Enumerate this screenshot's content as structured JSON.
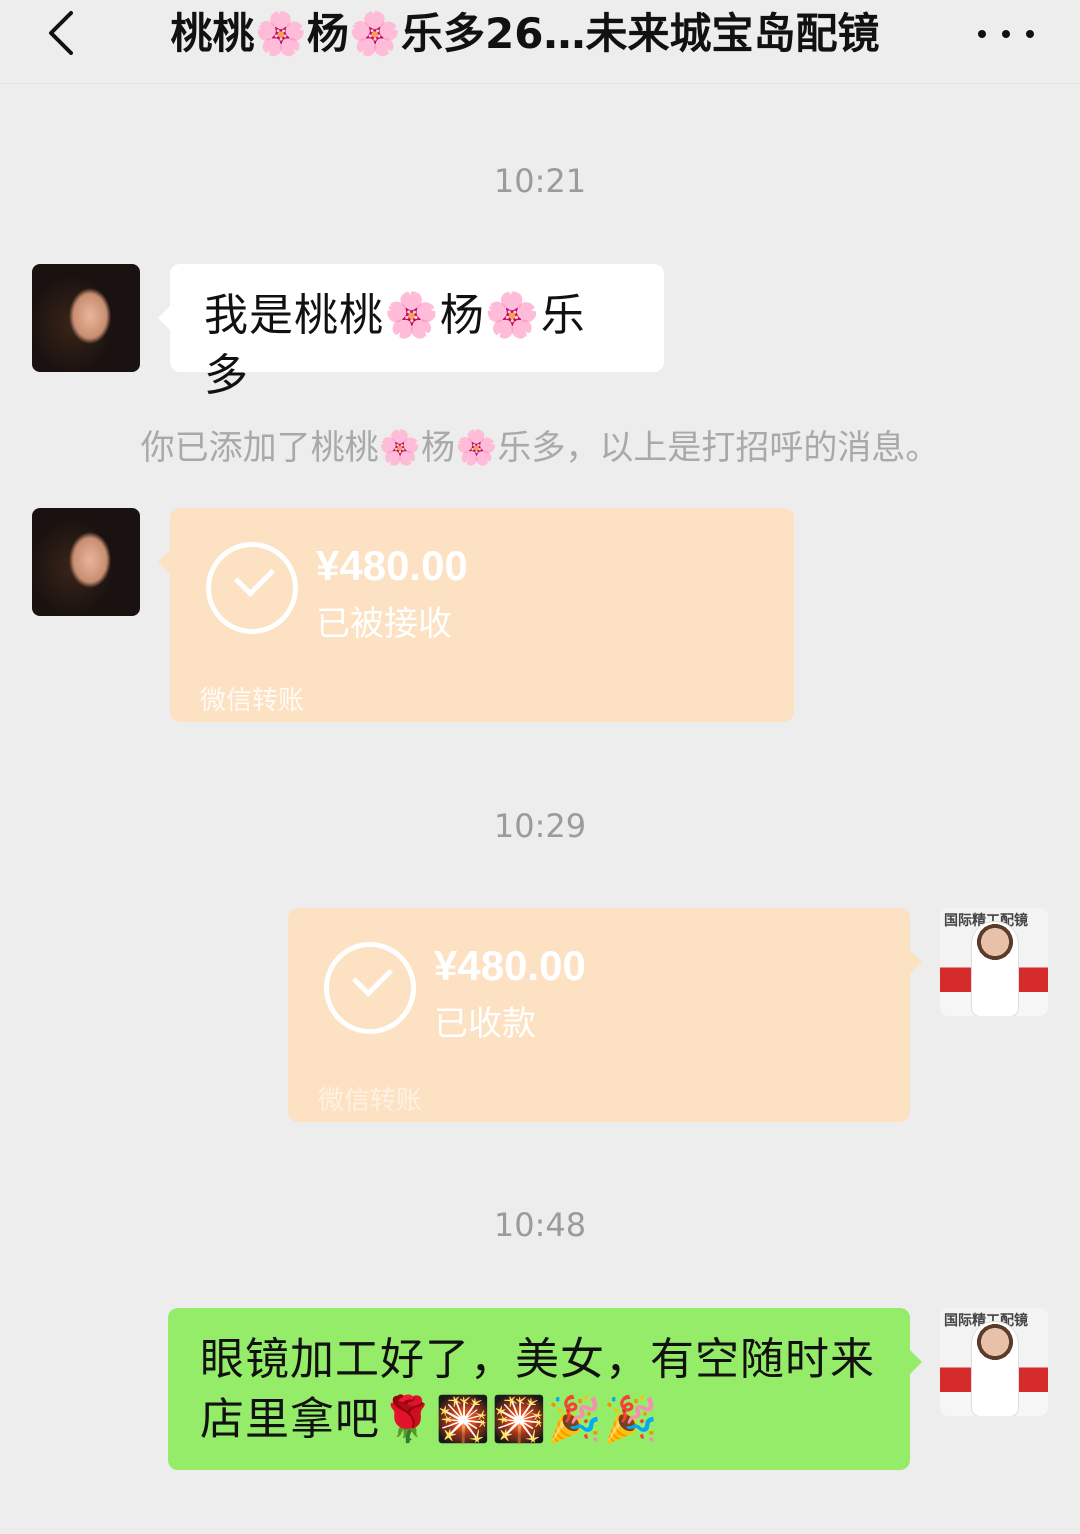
{
  "header": {
    "title": "桃桃🌸杨🌸乐多26…未来城宝岛配镜"
  },
  "messages": {
    "time1": "10:21",
    "greeting": "我是桃桃🌸杨🌸乐多",
    "system": "你已添加了桃桃🌸杨🌸乐多，以上是打招呼的消息。",
    "transfer1": {
      "amount": "¥480.00",
      "status": "已被接收",
      "footer": "微信转账"
    },
    "time2": "10:29",
    "transfer2": {
      "amount": "¥480.00",
      "status": "已收款",
      "footer": "微信转账"
    },
    "time3": "10:48",
    "final": "眼镜加工好了，美女，有空随时来店里拿吧🌹🎇🎇🎉🎉"
  },
  "avatars": {
    "shop_text": "国际精工配镜"
  },
  "colors": {
    "background": "#ededed",
    "green_bubble": "#95ec69",
    "transfer_bg": "#fde1c3"
  }
}
